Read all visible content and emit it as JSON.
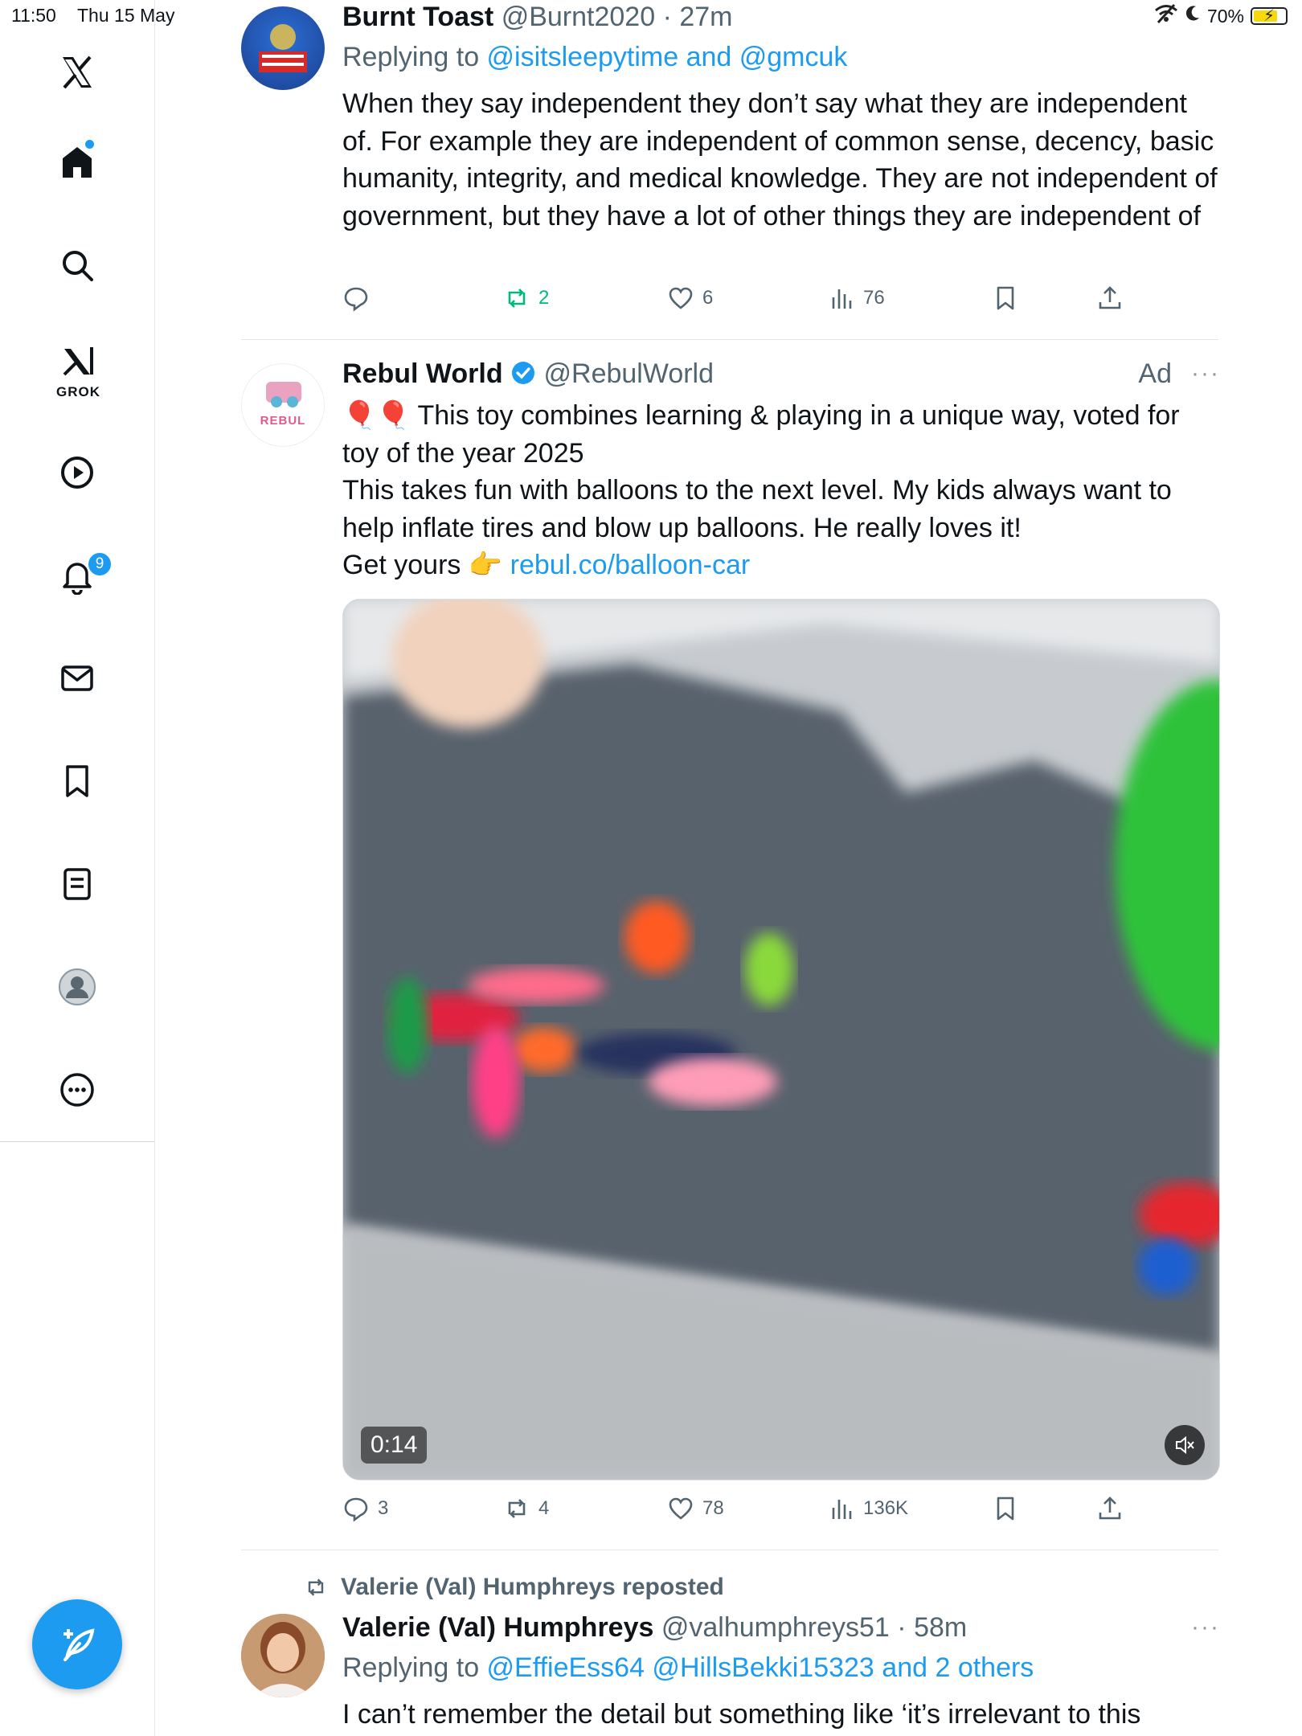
{
  "status_bar": {
    "time": "11:50",
    "date": "Thu 15 May",
    "battery": "70%"
  },
  "sidebar": {
    "grok_label": "GROK",
    "notification_count": "9"
  },
  "tweets": [
    {
      "name": "Burnt Toast",
      "handle": "@Burnt2020",
      "time": "27m",
      "replying_prefix": "Replying to ",
      "replying_to": "@isitsleepytime and @gmcuk",
      "body": "When they say independent they don’t say what they are independent of. For example they are independent of common sense, decency, basic humanity, integrity, and medical knowledge. They are not independent of government, but they have a lot of other things they are independent of",
      "replies": "",
      "reposts": "2",
      "likes": "6",
      "views": "76"
    },
    {
      "name": "Rebul World",
      "handle": "@RebulWorld",
      "ad_label": "Ad",
      "avatar_text": "REBUL",
      "body_line1": "🎈🎈 This toy combines learning & playing in a unique way, voted for toy of the year 2025",
      "body_line2": "This takes fun with balloons to the next level. My kids always want to help inflate tires and blow up balloons. He really loves it!",
      "body_line3_prefix": "Get yours 👉 ",
      "body_link": "rebul.co/balloon-car",
      "video_duration": "0:14",
      "replies": "3",
      "reposts": "4",
      "likes": "78",
      "views": "136K"
    },
    {
      "repost_by": "Valerie (Val) Humphreys reposted",
      "name": "Valerie (Val) Humphreys",
      "handle": "@valhumphreys51",
      "time": "58m",
      "replying_prefix": "Replying to ",
      "replying_to": "@EffieEss64 @HillsBekki15323 and 2 others",
      "body": "I can’t remember the detail but something like ‘it’s irrelevant to this"
    }
  ],
  "colors": {
    "accent": "#1d9bf0",
    "repost_green": "#00ba7c",
    "muted": "#536471"
  }
}
